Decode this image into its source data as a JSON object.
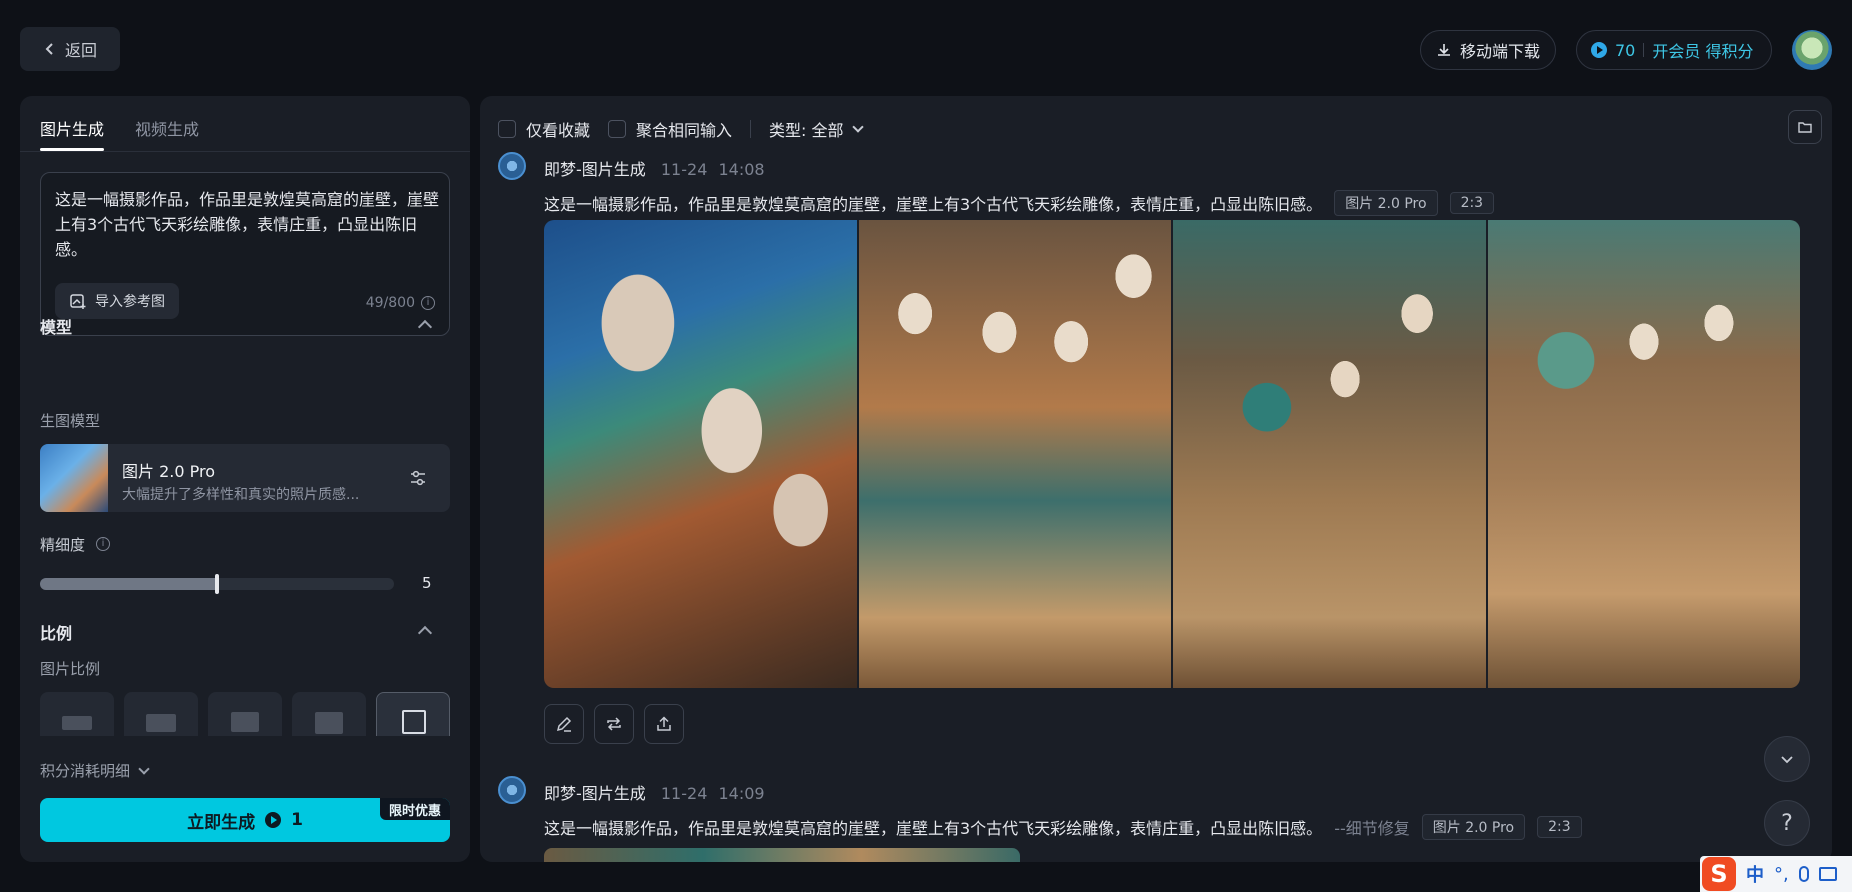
{
  "header": {
    "back_label": "返回",
    "mobile_download_label": "移动端下载",
    "points_value": "70",
    "vip_label": "开会员 得积分"
  },
  "left_panel": {
    "tabs": [
      {
        "label": "图片生成",
        "active": true
      },
      {
        "label": "视频生成",
        "active": false
      }
    ],
    "prompt": {
      "value": "这是一幅摄影作品，作品里是敦煌莫高窟的崖壁，崖壁上有3个古代飞天彩绘雕像，表情庄重，凸显出陈旧感。",
      "import_ref_label": "导入参考图",
      "counter": "49/800"
    },
    "model_section": {
      "title": "模型",
      "sub_label": "生图模型",
      "model_name": "图片 2.0 Pro",
      "model_desc": "大幅提升了多样性和真实的照片质感..."
    },
    "detail": {
      "label": "精细度",
      "value": "5",
      "fraction": 0.5
    },
    "ratio_section": {
      "title": "比例",
      "sub_label": "图片比例"
    },
    "cost_detail_label": "积分消耗明细",
    "generate": {
      "label": "立即生成",
      "cost": "1",
      "promo": "限时优惠"
    }
  },
  "right_panel": {
    "filters": {
      "favorites_label": "仅看收藏",
      "group_label": "聚合相同输入",
      "type_label": "类型: 全部"
    },
    "messages": [
      {
        "author": "即梦-图片生成",
        "date": "11-24",
        "time": "14:08",
        "prompt": "这是一幅摄影作品，作品里是敦煌莫高窟的崖壁，崖壁上有3个古代飞天彩绘雕像，表情庄重，凸显出陈旧感。",
        "suffix": "",
        "model_tag": "图片 2.0 Pro",
        "ratio_tag": "2:3"
      },
      {
        "author": "即梦-图片生成",
        "date": "11-24",
        "time": "14:09",
        "prompt": "这是一幅摄影作品，作品里是敦煌莫高窟的崖壁，崖壁上有3个古代飞天彩绘雕像，表情庄重，凸显出陈旧感。",
        "suffix": "--细节修复",
        "model_tag": "图片 2.0 Pro",
        "ratio_tag": "2:3"
      }
    ],
    "help_label": "?"
  },
  "ime": {
    "logo": "S",
    "lang": "中",
    "punct": "°,"
  }
}
